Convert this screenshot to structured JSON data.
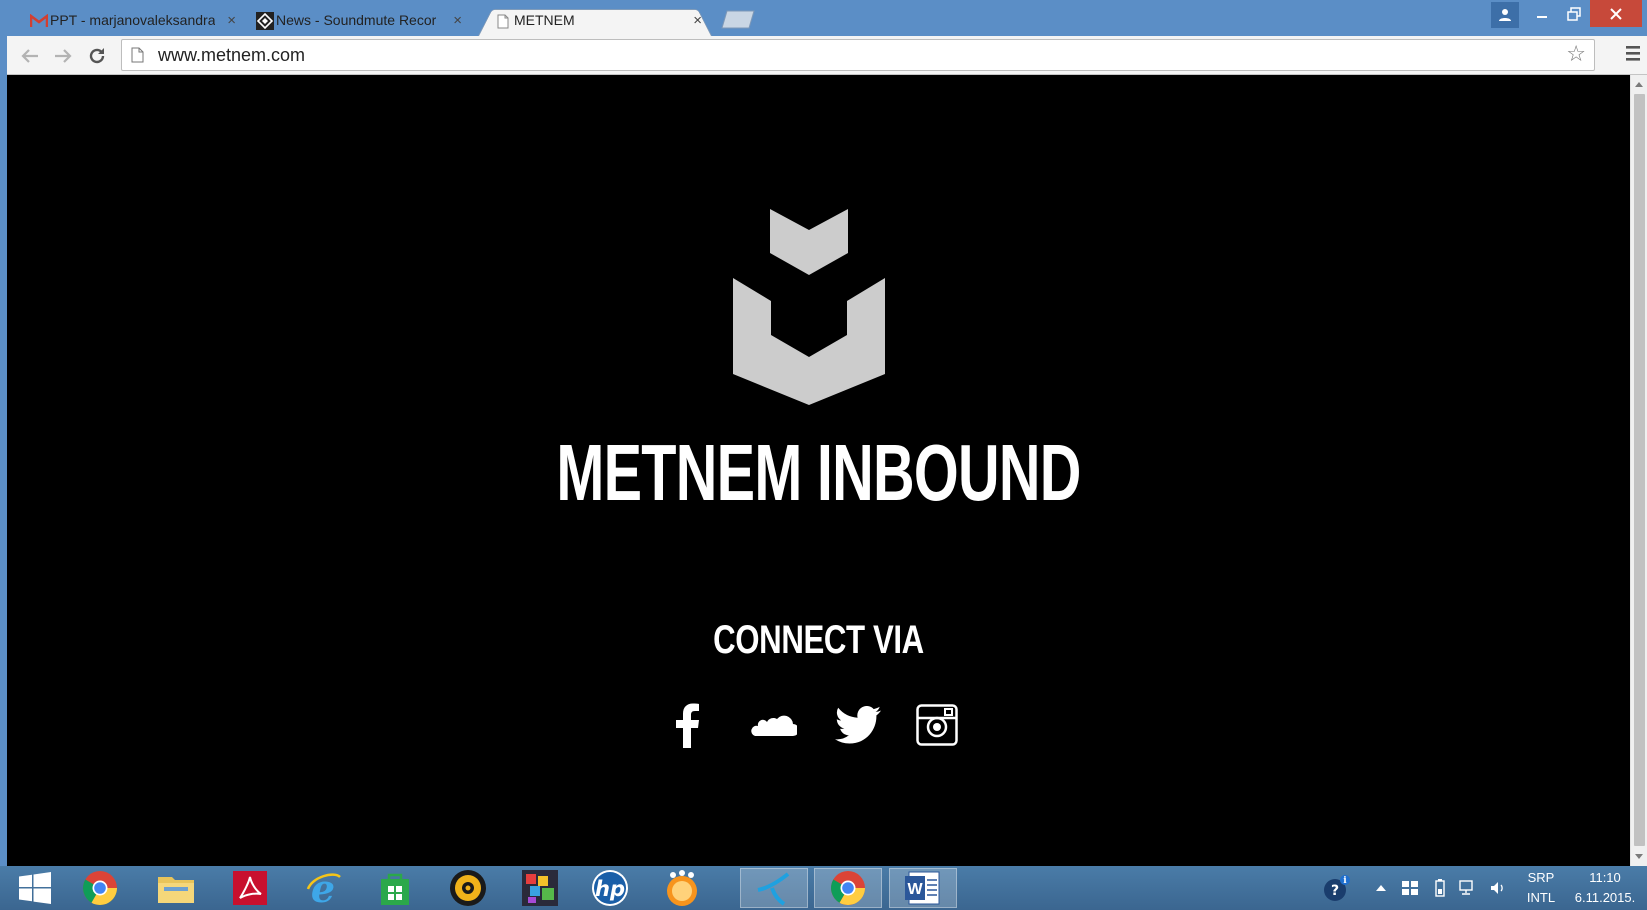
{
  "browser": {
    "tabs": [
      {
        "title": "PPT - marjanovaleksandra",
        "favicon": "gmail-icon"
      },
      {
        "title": "News - Soundmute Recor",
        "favicon": "soundmute-icon"
      },
      {
        "title": "METNEM",
        "favicon": "page-icon",
        "active": true
      }
    ],
    "address": "www.metnem.com"
  },
  "page": {
    "title": "METNEM INBOUND",
    "connect_label": "CONNECT VIA",
    "social": [
      "facebook-icon",
      "soundcloud-icon",
      "twitter-icon",
      "instagram-icon"
    ],
    "logo_color": "#cccccc",
    "background": "#000000"
  },
  "taskbar": {
    "apps": [
      "start-icon",
      "chrome-icon",
      "file-explorer-icon",
      "acrobat-icon",
      "internet-explorer-icon",
      "store-icon",
      "media-player-icon",
      "paint-icon",
      "hp-icon",
      "messenger-icon",
      "telenor-icon",
      "chrome-icon",
      "word-icon"
    ],
    "language_top": "SRP",
    "language_bottom": "INTL",
    "time": "11:10",
    "date": "6.11.2015."
  }
}
